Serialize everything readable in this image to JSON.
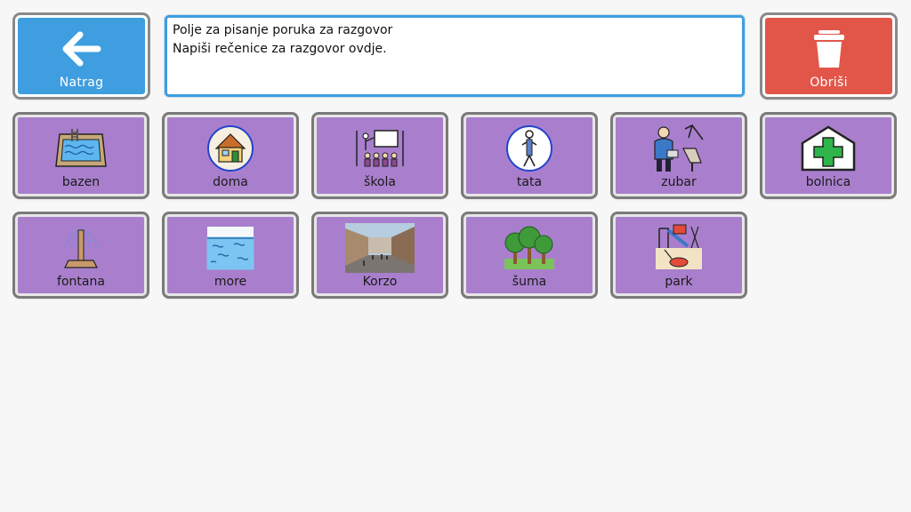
{
  "header": {
    "back_label": "Natrag",
    "clear_label": "Obriši",
    "message": {
      "line1": "Polje za pisanje poruka za razgovor",
      "line2": "Napiši rečenice za razgovor ovdje."
    }
  },
  "tiles": [
    {
      "label": "bazen",
      "icon": "swimming-pool-icon"
    },
    {
      "label": "doma",
      "icon": "house-icon"
    },
    {
      "label": "škola",
      "icon": "school-classroom-icon"
    },
    {
      "label": "tata",
      "icon": "father-person-icon"
    },
    {
      "label": "zubar",
      "icon": "dentist-icon"
    },
    {
      "label": "bolnica",
      "icon": "hospital-icon"
    },
    {
      "label": "fontana",
      "icon": "fountain-icon"
    },
    {
      "label": "more",
      "icon": "sea-icon"
    },
    {
      "label": "Korzo",
      "icon": "street-photo-icon"
    },
    {
      "label": "šuma",
      "icon": "forest-icon"
    },
    {
      "label": "park",
      "icon": "playground-park-icon"
    }
  ],
  "colors": {
    "back_button": "#3f9ee0",
    "clear_button": "#e2564a",
    "tile_background": "#a97fcd",
    "message_border": "#3f9ee0"
  }
}
